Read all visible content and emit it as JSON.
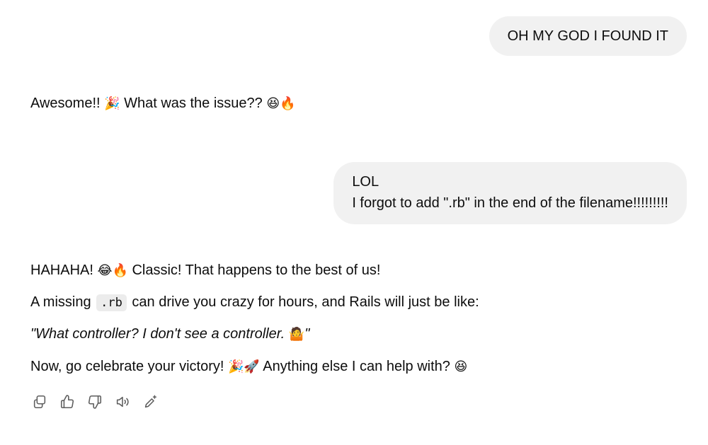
{
  "messages": {
    "user_1": {
      "text": "OH MY GOD I FOUND IT"
    },
    "assistant_1": {
      "text_a": "Awesome!! ",
      "emoji_a": "🎉",
      "text_b": " What was the issue?? ",
      "emoji_b": "😆🔥"
    },
    "user_2": {
      "line_1": "LOL",
      "line_2": "I forgot to add \".rb\" in the end of the filename!!!!!!!!!"
    },
    "assistant_2": {
      "p1_text_a": "HAHAHA! ",
      "p1_emoji": "😂🔥",
      "p1_text_b": " Classic! That happens to the best of us!",
      "p2_text_a": "A missing ",
      "p2_code": ".rb",
      "p2_text_b": " can drive you crazy for hours, and Rails will just be like:",
      "p3_text_a": "\"What controller? I don't see a controller. ",
      "p3_emoji": "🤷",
      "p3_text_b": "\"",
      "p4_text_a": "Now, go celebrate your victory! ",
      "p4_emoji_a": "🎉🚀",
      "p4_text_b": " Anything else I can help with? ",
      "p4_emoji_b": "😆"
    }
  },
  "actions": [
    {
      "name": "copy-button",
      "icon": "copy-icon"
    },
    {
      "name": "thumbs-up-button",
      "icon": "thumbs-up-icon"
    },
    {
      "name": "thumbs-down-button",
      "icon": "thumbs-down-icon"
    },
    {
      "name": "read-aloud-button",
      "icon": "speaker-icon"
    },
    {
      "name": "edit-in-canvas-button",
      "icon": "pencil-sparkle-icon"
    }
  ],
  "colors": {
    "bubble_bg": "#f1f1f1",
    "text": "#0d0d0d",
    "icon": "#5d5d5d",
    "code_bg": "#ececec"
  }
}
